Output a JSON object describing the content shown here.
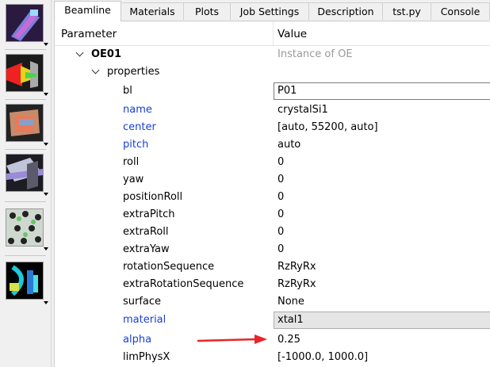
{
  "tabs": [
    "Beamline",
    "Materials",
    "Plots",
    "Job Settings",
    "Description",
    "tst.py",
    "Console"
  ],
  "header": {
    "parameter": "Parameter",
    "value": "Value"
  },
  "tree": {
    "root_label": "OE01",
    "root_value": "Instance of OE",
    "group_label": "properties"
  },
  "rows": [
    {
      "param": "bl",
      "value": "P01"
    },
    {
      "param": "name",
      "value": "crystalSi1"
    },
    {
      "param": "center",
      "value": "[auto, 55200, auto]"
    },
    {
      "param": "pitch",
      "value": "auto"
    },
    {
      "param": "roll",
      "value": "0"
    },
    {
      "param": "yaw",
      "value": "0"
    },
    {
      "param": "positionRoll",
      "value": "0"
    },
    {
      "param": "extraPitch",
      "value": "0"
    },
    {
      "param": "extraRoll",
      "value": "0"
    },
    {
      "param": "extraYaw",
      "value": "0"
    },
    {
      "param": "rotationSequence",
      "value": "RzRyRx"
    },
    {
      "param": "extraRotationSequence",
      "value": "RzRyRx"
    },
    {
      "param": "surface",
      "value": "None"
    },
    {
      "param": "material",
      "value": "xtal1"
    },
    {
      "param": "alpha",
      "value": "0.25"
    },
    {
      "param": "limPhysX",
      "value": "[-1000.0, 1000.0]"
    }
  ],
  "toolbar_icons": [
    "sources-icon",
    "apertures-icon",
    "optical-elements-icon",
    "screens-icon",
    "materials-icon",
    "plots-icon"
  ],
  "colors": {
    "modified_param": "#1a3fd1",
    "annotation_arrow": "#e8242a",
    "placeholder": "#9a9a9a"
  }
}
